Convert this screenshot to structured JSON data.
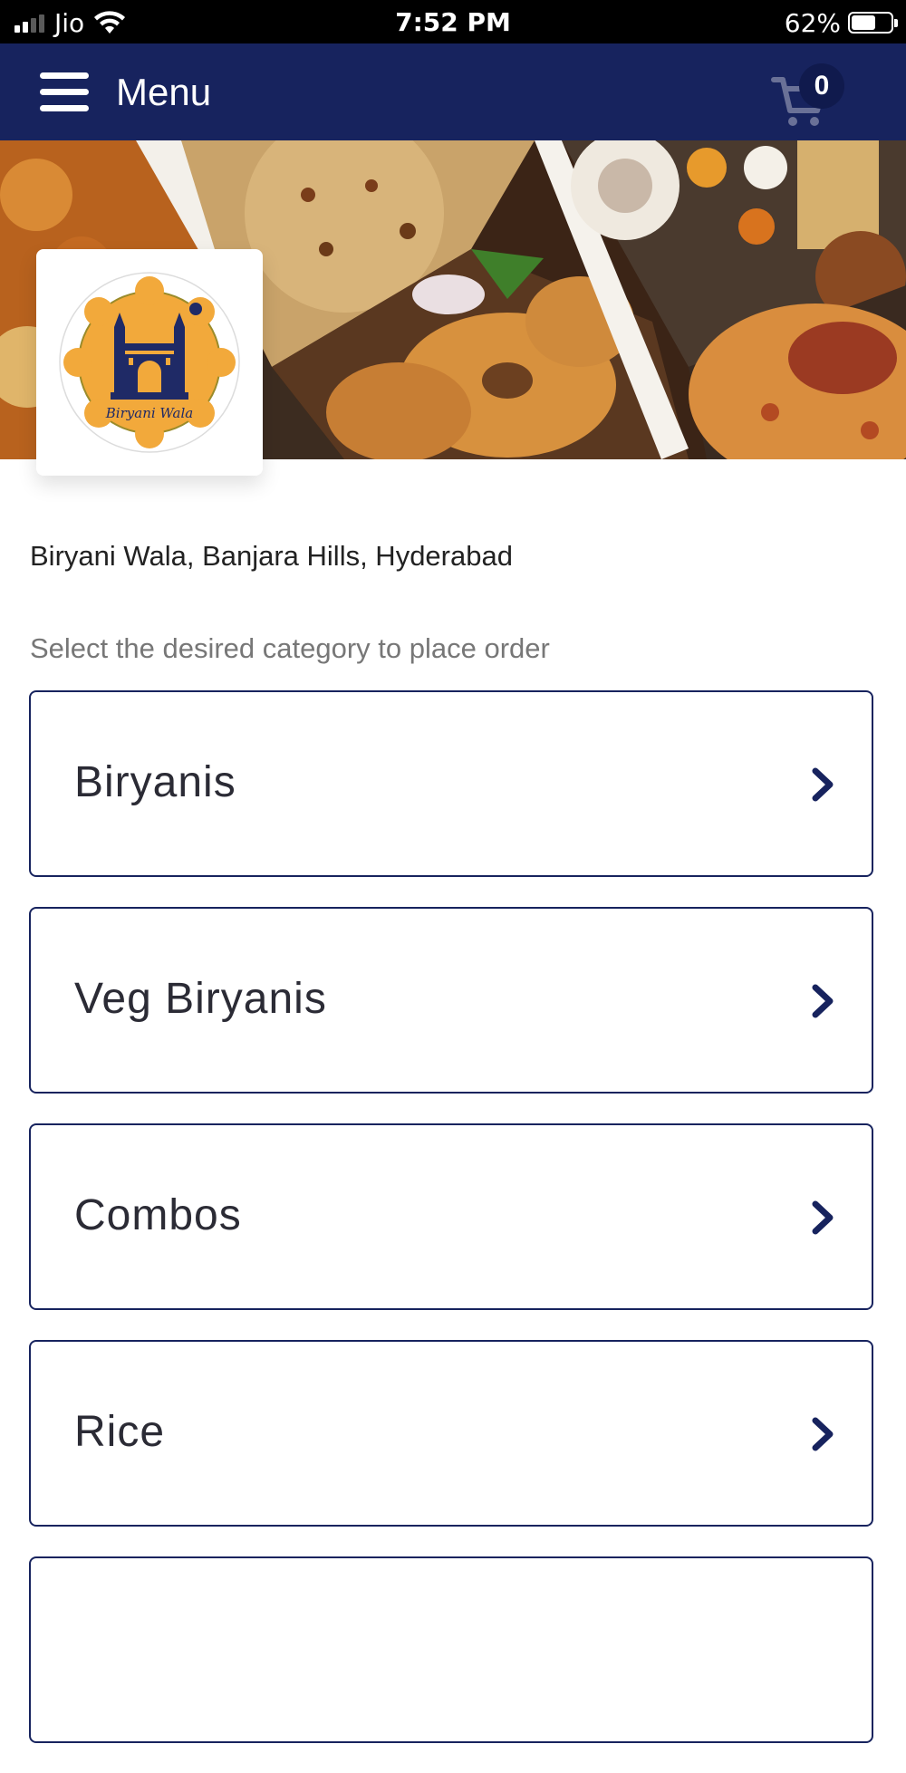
{
  "status_bar": {
    "carrier": "Jio",
    "time": "7:52 PM",
    "battery_percent": "62%",
    "battery_level": 0.62,
    "signal_bars_active": 2,
    "signal_bars_total": 4
  },
  "header": {
    "title": "Menu",
    "cart_count": "0",
    "background_color": "#17235e"
  },
  "restaurant": {
    "name": "Biryani Wala, Banjara Hills, Hyderabad",
    "logo_text": "Biryani Wala"
  },
  "instruction": "Select the desired category to place order",
  "categories": [
    {
      "label": "Biryanis"
    },
    {
      "label": "Veg Biryanis"
    },
    {
      "label": "Combos"
    },
    {
      "label": "Rice"
    },
    {
      "label": ""
    }
  ],
  "colors": {
    "accent": "#17235e",
    "logo_gold": "#f2a93b"
  },
  "icons": {
    "menu": "hamburger-icon",
    "cart": "cart-icon",
    "chevron": "chevron-right-icon"
  }
}
